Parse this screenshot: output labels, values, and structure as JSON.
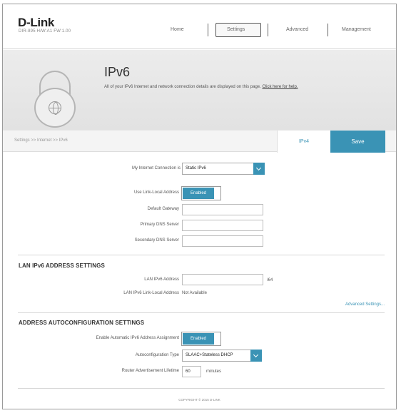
{
  "header": {
    "brand": "D-Link",
    "brand_sub": "DIR-895  H/W:A1  FW:1.00",
    "nav": {
      "home": "Home",
      "settings": "Settings",
      "advanced": "Advanced",
      "management": "Management"
    }
  },
  "banner": {
    "title": "IPv6",
    "description": "All of your IPv6 Internet and network connection details are displayed on this page.",
    "help_link": "Click here for help."
  },
  "toolbar": {
    "breadcrumb": "Settings >> Internet >> IPv6",
    "ipv4_label": "IPv4",
    "save_label": "Save"
  },
  "ipv6": {
    "connection_label": "My Internet Connection is",
    "connection_value": "Static IPv6",
    "link_local_label": "Use Link-Local Address",
    "link_local_value": "Enabled",
    "gateway_label": "Default Gateway",
    "primary_dns_label": "Primary DNS Server",
    "secondary_dns_label": "Secondary DNS Server"
  },
  "lan": {
    "section_title": "LAN IPv6 ADDRESS SETTINGS",
    "address_label": "LAN IPv6 Address",
    "prefix_suffix": "/64",
    "link_local_label": "LAN IPv6 Link-Local Address",
    "link_local_value": "Not Available",
    "advanced_link": "Advanced Settings..."
  },
  "autoconfig": {
    "section_title": "ADDRESS AUTOCONFIGURATION SETTINGS",
    "enable_label": "Enable Automatic IPv6 Address Assignment",
    "enable_value": "Enabled",
    "type_label": "Autoconfiguration Type",
    "type_value": "SLAAC+Stateless DHCP",
    "lifetime_label": "Router Advertisement Lifetime",
    "lifetime_value": "60",
    "lifetime_unit": "minutes"
  },
  "footer": {
    "copyright": "COPYRIGHT © 2015 D-LINK"
  },
  "colors": {
    "accent": "#3a93b5",
    "banner_bg": "#e6e6e6"
  }
}
